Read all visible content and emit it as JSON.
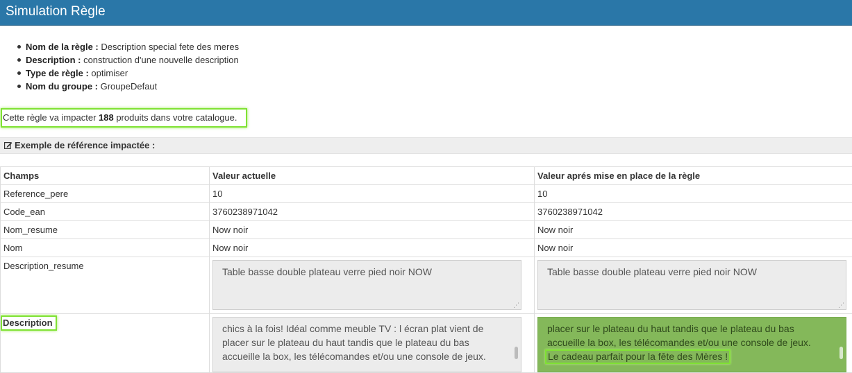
{
  "header": {
    "title": "Simulation Règle"
  },
  "rule_info": {
    "items": [
      {
        "label": "Nom de la règle",
        "value": "Description special fete des meres"
      },
      {
        "label": "Description",
        "value": "construction d'une nouvelle description"
      },
      {
        "label": "Type de règle",
        "value": "optimiser"
      },
      {
        "label": "Nom du groupe",
        "value": "GroupeDefaut"
      }
    ],
    "separator": " : "
  },
  "impact": {
    "prefix": "Cette règle va impacter ",
    "count": "188",
    "suffix": " produits dans votre catalogue."
  },
  "example_section": {
    "icon": "edit-icon",
    "title": "Exemple de référence impactée :"
  },
  "table": {
    "headers": {
      "field": "Champs",
      "current": "Valeur actuelle",
      "after": "Valeur aprés mise en place de la règle"
    },
    "rows": [
      {
        "field": "Reference_pere",
        "current": "10",
        "after": "10"
      },
      {
        "field": "Code_ean",
        "current": "3760238971042",
        "after": "3760238971042"
      },
      {
        "field": "Nom_resume",
        "current": "Now noir",
        "after": "Now noir"
      },
      {
        "field": "Nom",
        "current": "Now noir",
        "after": "Now noir"
      }
    ],
    "description_resume": {
      "field": "Description_resume",
      "current": "Table basse double plateau verre pied noir NOW",
      "after": "Table basse double plateau verre pied noir NOW"
    },
    "description": {
      "field": "Description",
      "current_lines": [
        "chics à la fois! Idéal comme meuble TV : l écran plat vient de",
        "placer sur le plateau du haut tandis que le plateau du bas",
        "accueille la box, les télécomandes et/ou une console de jeux."
      ],
      "after_lines": [
        "placer sur le plateau du haut tandis que le plateau du bas",
        "accueille la box, les télécomandes et/ou une console de jeux."
      ],
      "after_highlight": "Le cadeau parfait pour la fête des Mères !"
    }
  },
  "colors": {
    "header_bg": "#2a77a8",
    "highlight_border": "#80e234",
    "changed_value_bg": "#84b85a"
  }
}
